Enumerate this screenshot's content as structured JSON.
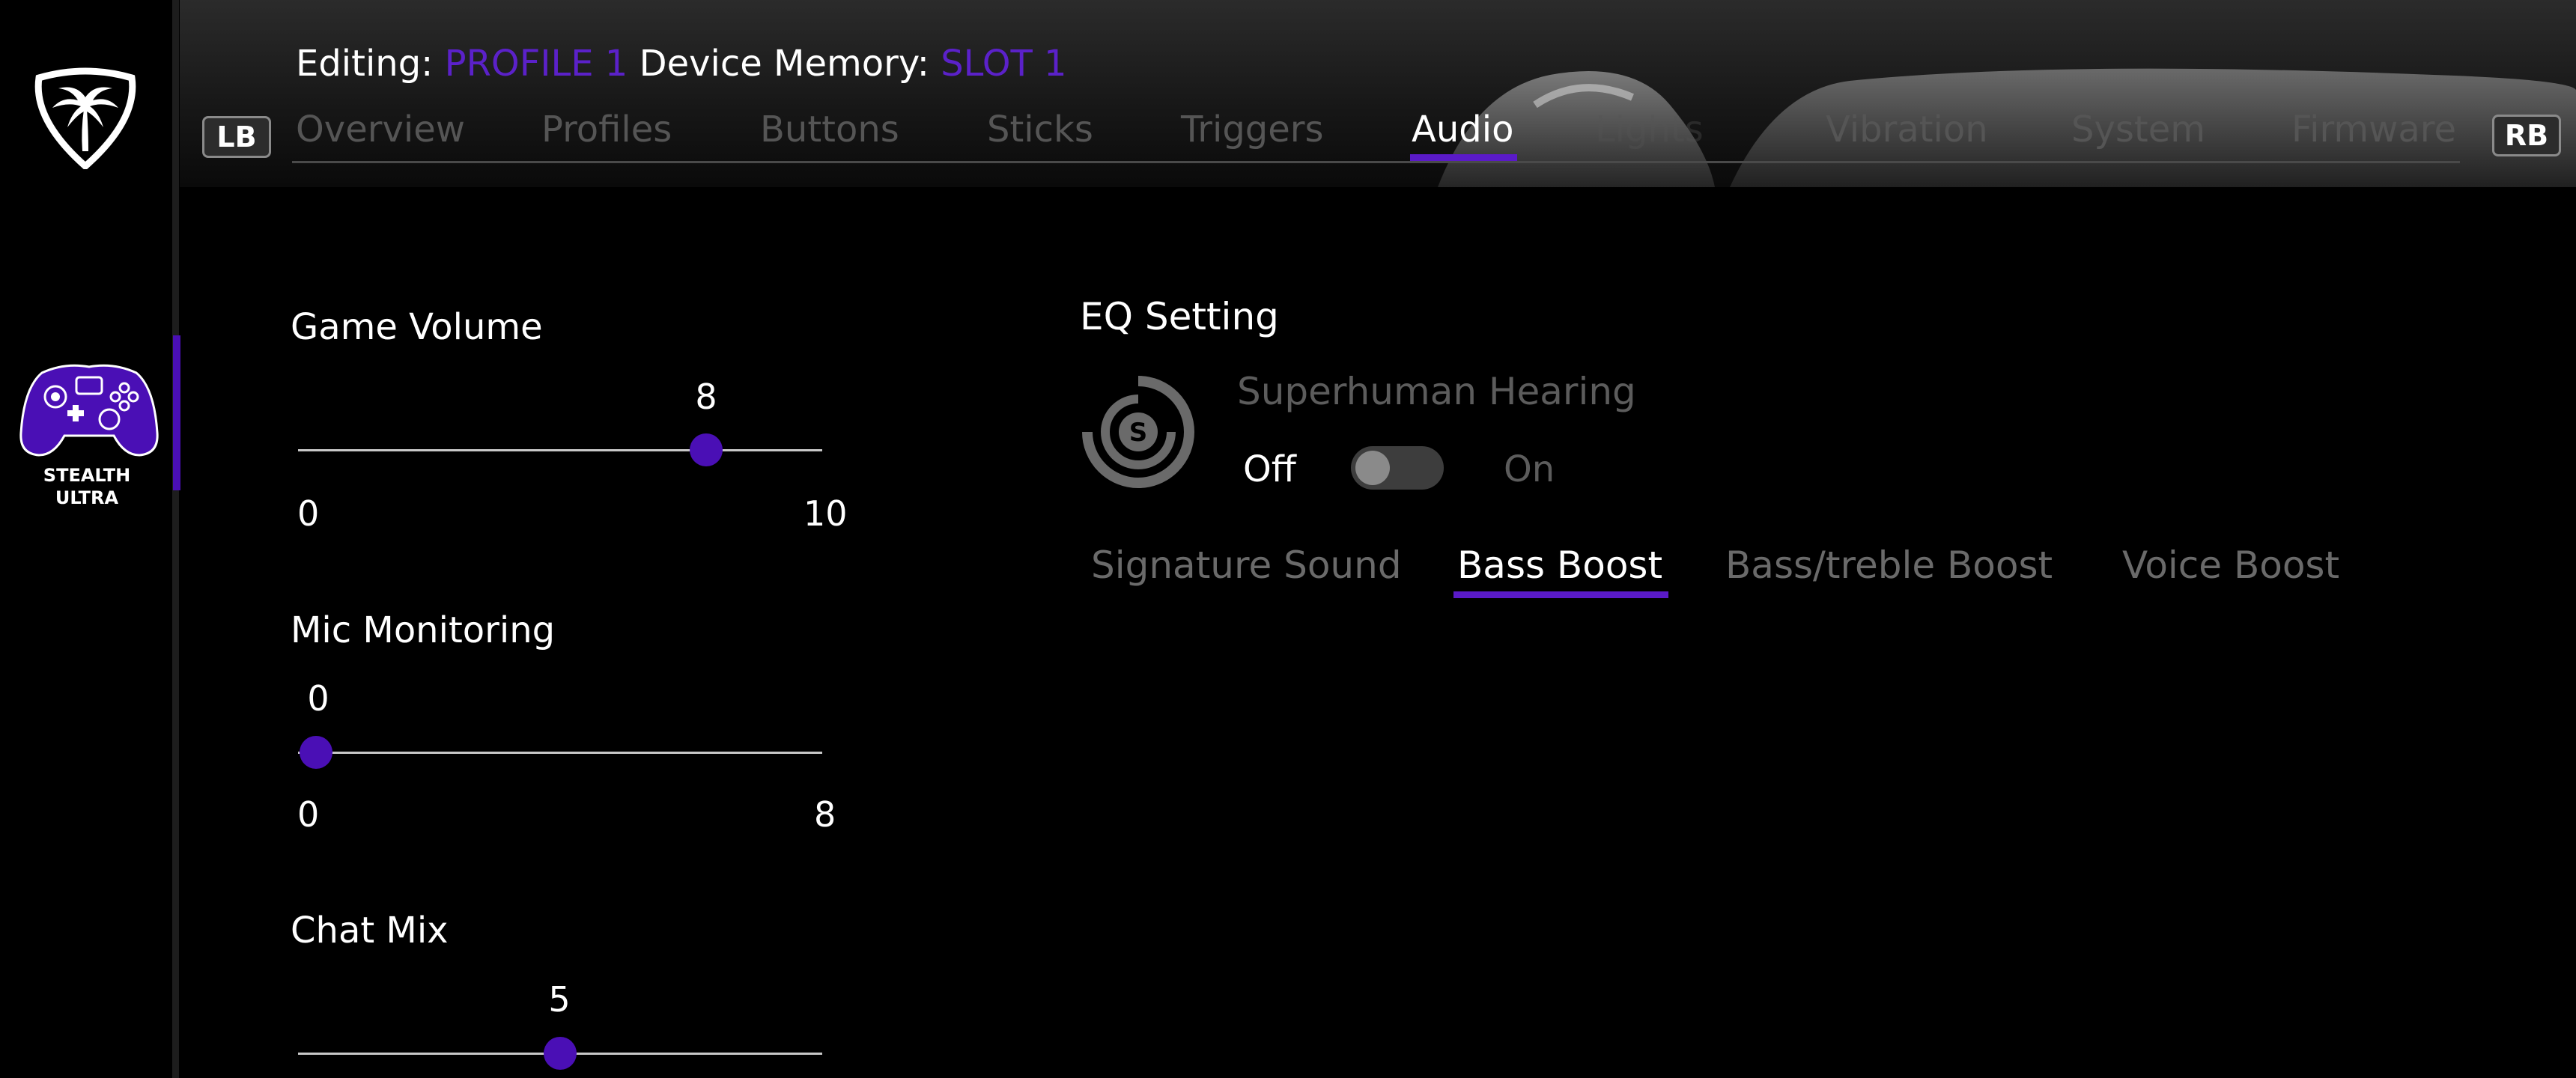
{
  "sidebar": {
    "device_name_line1": "STEALTH",
    "device_name_line2": "ULTRA",
    "logo_icon": "palm-tree-shield-icon",
    "device_icon": "controller-icon",
    "accent_color": "#4a0fb5"
  },
  "header": {
    "editing_label": "Editing:",
    "profile_value": "PROFILE 1",
    "memory_label": "Device Memory:",
    "slot_value": "SLOT 1",
    "lb_label": "LB",
    "rb_label": "RB",
    "tabs": [
      {
        "label": "Overview"
      },
      {
        "label": "Profiles"
      },
      {
        "label": "Buttons"
      },
      {
        "label": "Sticks"
      },
      {
        "label": "Triggers"
      },
      {
        "label": "Audio"
      },
      {
        "label": "Lights"
      },
      {
        "label": "Vibration"
      },
      {
        "label": "System"
      },
      {
        "label": "Firmware"
      }
    ],
    "active_tab": "Audio"
  },
  "audio": {
    "game_volume": {
      "label": "Game Volume",
      "value": 8,
      "value_text": "8",
      "min": "0",
      "max": "10"
    },
    "mic_monitoring": {
      "label": "Mic Monitoring",
      "value": 0,
      "value_text": "0",
      "min": "0",
      "max": "8"
    },
    "chat_mix": {
      "label": "Chat Mix",
      "value": 5,
      "value_text": "5"
    }
  },
  "eq": {
    "title": "EQ Setting",
    "superhuman_label": "Superhuman Hearing",
    "superhuman_icon": "superhuman-hearing-icon",
    "toggle_off_label": "Off",
    "toggle_on_label": "On",
    "toggle_state": "off",
    "presets": [
      {
        "label": "Signature Sound"
      },
      {
        "label": "Bass Boost"
      },
      {
        "label": "Bass/treble Boost"
      },
      {
        "label": "Voice Boost"
      }
    ],
    "active_preset": "Bass Boost"
  },
  "colors": {
    "accent": "#5a1ac8",
    "inactive_text": "#555555",
    "background": "#000000"
  }
}
